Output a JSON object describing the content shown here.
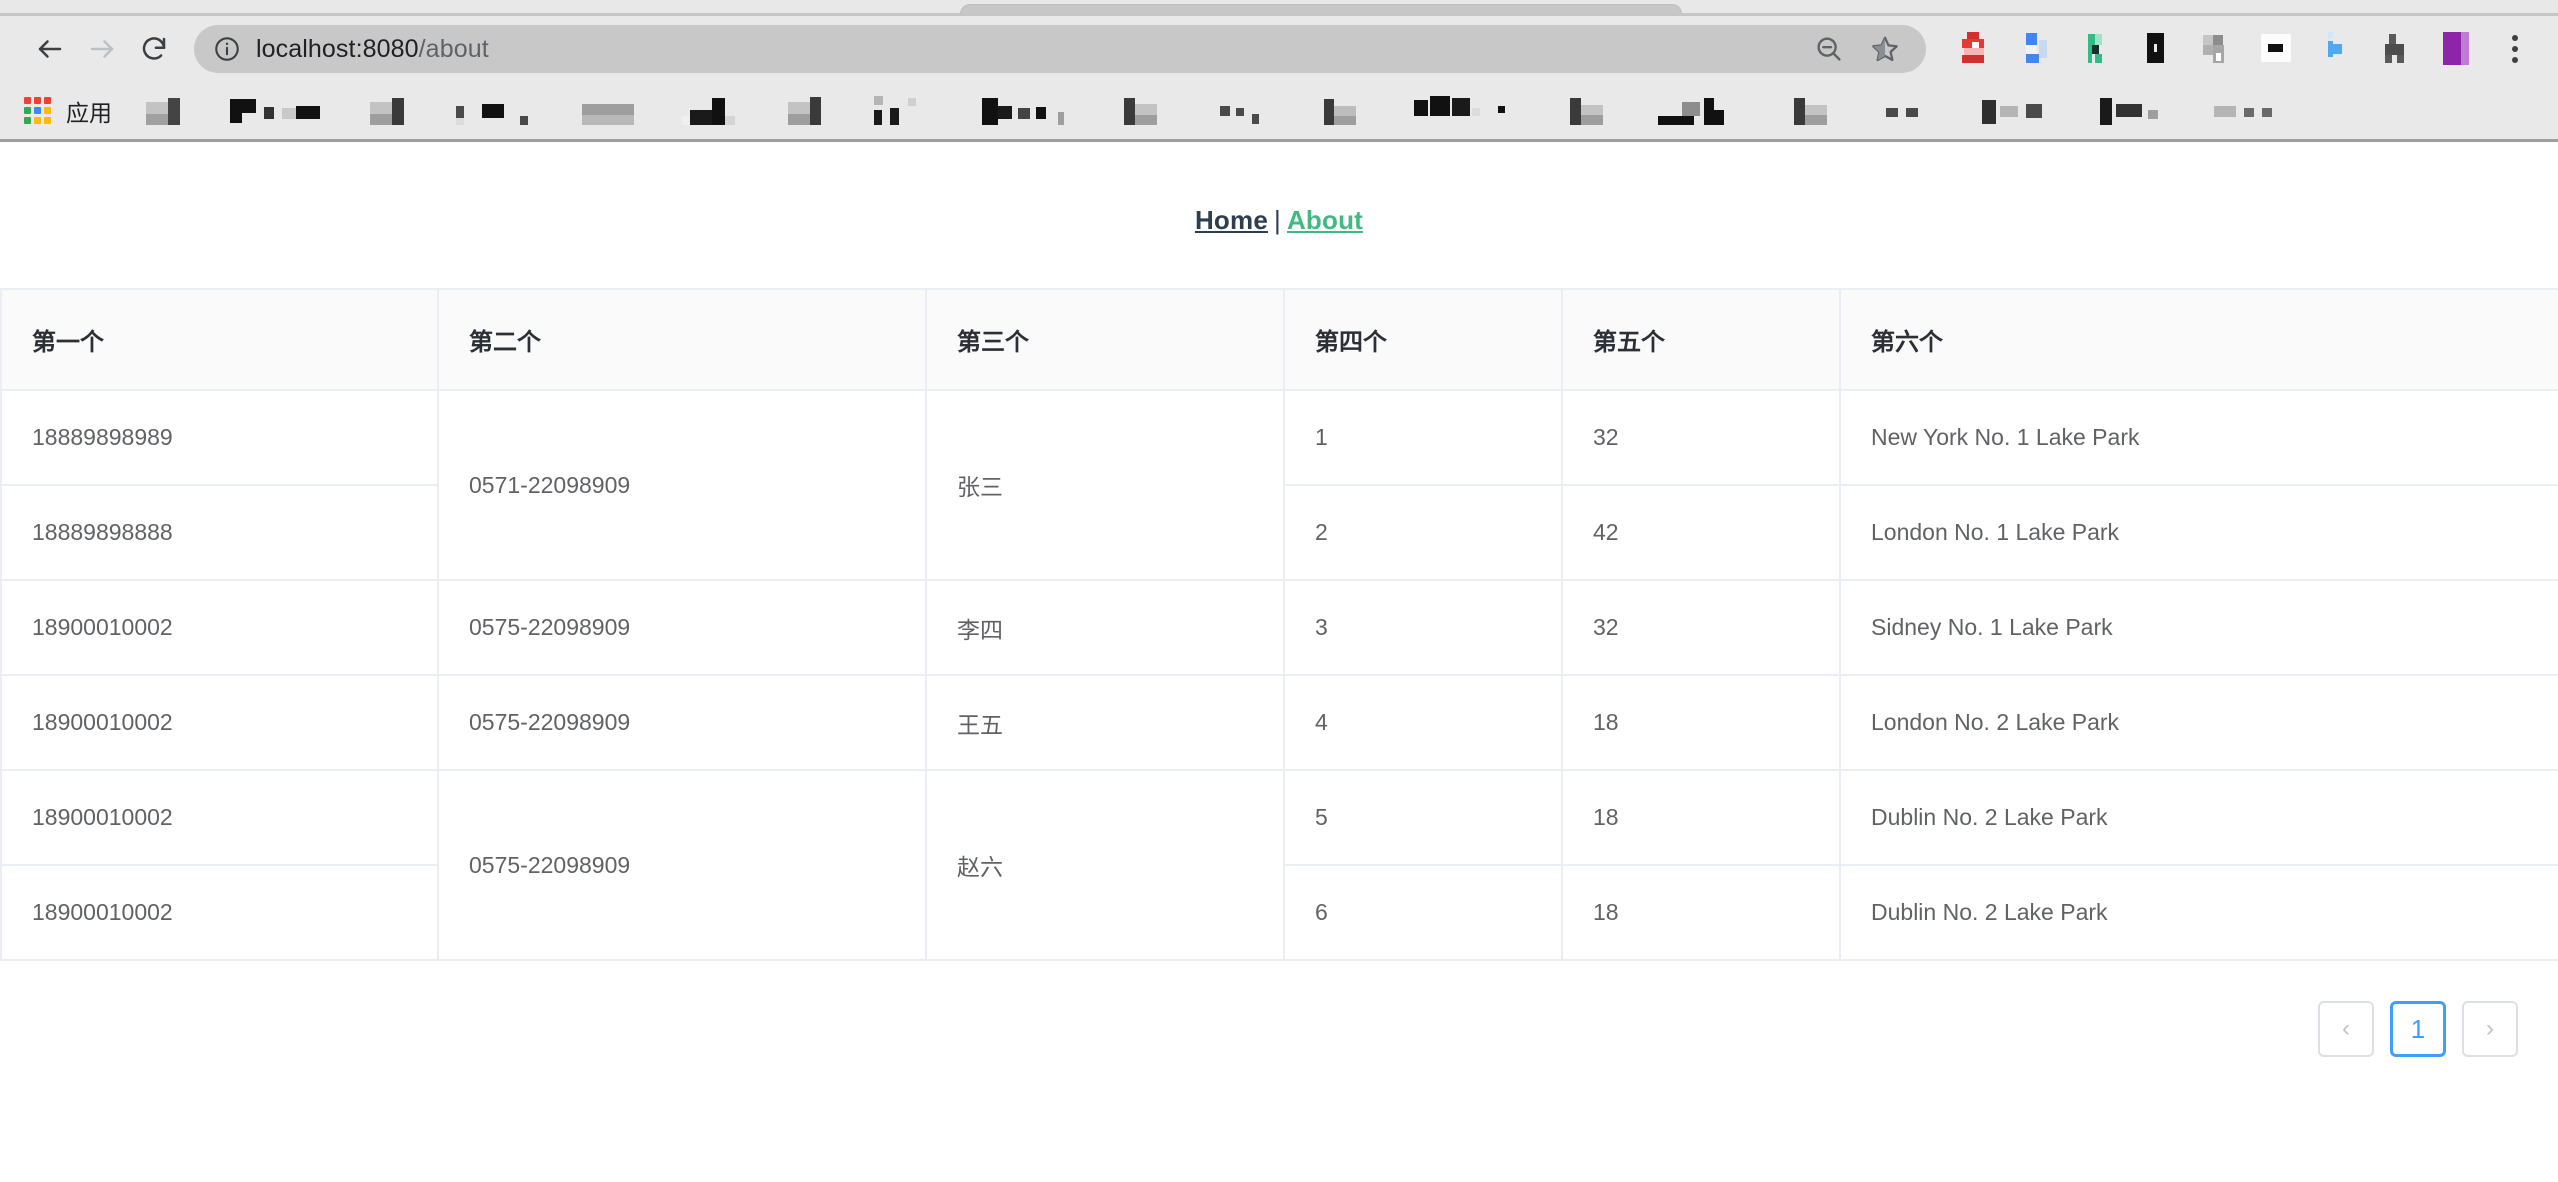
{
  "browser": {
    "nav": {
      "back_label": "Back",
      "forward_label": "Forward",
      "reload_label": "Reload"
    },
    "omnibox": {
      "info_icon": "info-circle-icon",
      "url_host": "localhost:8080",
      "url_path": "/about",
      "full_url": "localhost:8080/about",
      "zoom_icon": "zoom-out-icon",
      "bookmark_icon": "star-icon"
    },
    "extensions": [
      {
        "name": "extension-red",
        "color": "#d32f2f"
      },
      {
        "name": "extension-blue",
        "color": "#4285f4"
      },
      {
        "name": "extension-green",
        "color": "#2ebd85"
      },
      {
        "name": "extension-black",
        "color": "#111111"
      },
      {
        "name": "extension-gray",
        "color": "#9e9e9e"
      },
      {
        "name": "extension-white",
        "color": "#1a1a1a"
      },
      {
        "name": "extension-lightblue",
        "color": "#4fa8f5"
      },
      {
        "name": "extension-darkgray",
        "color": "#5a5a5a"
      },
      {
        "name": "extension-purple",
        "color": "#8e24aa"
      }
    ],
    "menu_icon": "kebab-menu-icon",
    "bookmarks_bar": {
      "apps_label": "应用",
      "apps_icon": "apps-grid-icon",
      "apps_grid_colors": [
        "#ea4335",
        "#ea4335",
        "#ea4335",
        "#34a853",
        "#4285f4",
        "#fbbc05",
        "#34a853",
        "#fbbc05",
        "#fbbc05"
      ],
      "items": [
        {
          "name": "bookmark-1"
        },
        {
          "name": "bookmark-2"
        },
        {
          "name": "bookmark-3"
        },
        {
          "name": "bookmark-4"
        },
        {
          "name": "bookmark-5"
        },
        {
          "name": "bookmark-6"
        },
        {
          "name": "bookmark-7"
        },
        {
          "name": "bookmark-8"
        },
        {
          "name": "bookmark-9"
        },
        {
          "name": "bookmark-10"
        },
        {
          "name": "bookmark-11"
        },
        {
          "name": "bookmark-12"
        },
        {
          "name": "bookmark-13"
        },
        {
          "name": "bookmark-14"
        },
        {
          "name": "bookmark-15"
        },
        {
          "name": "bookmark-16"
        },
        {
          "name": "bookmark-17"
        },
        {
          "name": "bookmark-18"
        },
        {
          "name": "bookmark-19"
        },
        {
          "name": "bookmark-20"
        }
      ]
    }
  },
  "page": {
    "nav": {
      "home_label": "Home",
      "separator": "|",
      "about_label": "About",
      "home_color": "#2c3e50",
      "about_color": "#42b983"
    },
    "table": {
      "headers": [
        "第一个",
        "第二个",
        "第三个",
        "第四个",
        "第五个",
        "第六个"
      ],
      "rows": [
        {
          "col1": "18889898989",
          "col2": "0571-22098909",
          "col2_rowspan": 2,
          "col3": "张三",
          "col3_rowspan": 2,
          "col4": "1",
          "col5": "32",
          "col6": "New York No. 1 Lake Park"
        },
        {
          "col1": "18889898888",
          "col4": "2",
          "col5": "42",
          "col6": "London No. 1 Lake Park"
        },
        {
          "col1": "18900010002",
          "col2": "0575-22098909",
          "col2_rowspan": 1,
          "col3": "李四",
          "col3_rowspan": 1,
          "col4": "3",
          "col5": "32",
          "col6": "Sidney No. 1 Lake Park"
        },
        {
          "col1": "18900010002",
          "col2": "0575-22098909",
          "col2_rowspan": 1,
          "col3": "王五",
          "col3_rowspan": 1,
          "col4": "4",
          "col5": "18",
          "col6": "London No. 2 Lake Park"
        },
        {
          "col1": "18900010002",
          "col2": "0575-22098909",
          "col2_rowspan": 2,
          "col3": "赵六",
          "col3_rowspan": 2,
          "col4": "5",
          "col5": "18",
          "col6": "Dublin No. 2 Lake Park"
        },
        {
          "col1": "18900010002",
          "col4": "6",
          "col5": "18",
          "col6": "Dublin No. 2 Lake Park"
        }
      ]
    },
    "pagination": {
      "prev_label": "‹",
      "next_label": "›",
      "current_page": "1",
      "active_color": "#409eff"
    }
  }
}
